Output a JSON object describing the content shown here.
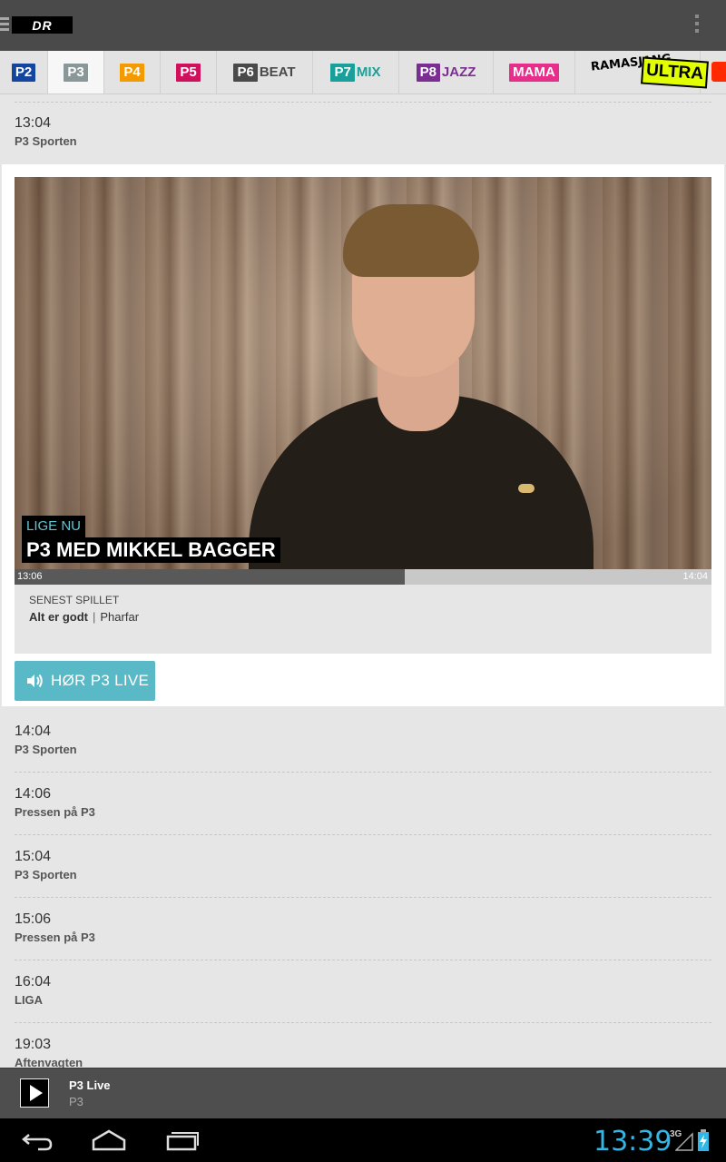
{
  "app": {
    "logo_text": "DR",
    "menu_icon": "hamburger-icon",
    "overflow_icon": "overflow-menu-icon"
  },
  "channels": [
    {
      "label": "P2",
      "color": "#1446a0",
      "suffix": ""
    },
    {
      "label": "P3",
      "color": "#8a9799",
      "suffix": "",
      "active": true
    },
    {
      "label": "P4",
      "color": "#f39a00",
      "suffix": ""
    },
    {
      "label": "P5",
      "color": "#d0105d",
      "suffix": ""
    },
    {
      "label": "P6",
      "color": "#4a4a4a",
      "suffix": "BEAT"
    },
    {
      "label": "P7",
      "color": "#1aa09a",
      "suffix": "MIX"
    },
    {
      "label": "P8",
      "color": "#7a2e92",
      "suffix": "JAZZ"
    },
    {
      "label": "MAMA",
      "color": "#e62e8a",
      "suffix": ""
    },
    {
      "label": "RAMASJANG",
      "color": "#e2ff00",
      "suffix": "ULTRA"
    }
  ],
  "schedule_before": [
    {
      "time": "13:04",
      "title": "P3 Sporten"
    }
  ],
  "now_playing": {
    "badge": "LIGE NU",
    "title": "P3 MED MIKKEL BAGGER",
    "start_time": "13:06",
    "end_time": "14:04",
    "progress": 0.56,
    "recent_label": "SENEST SPILLET",
    "recent_track": "Alt er godt",
    "recent_separator": "|",
    "recent_artist": "Pharfar",
    "listen_label": "HØR P3 LIVE",
    "listen_icon": "speaker-icon"
  },
  "schedule_after": [
    {
      "time": "14:04",
      "title": "P3 Sporten"
    },
    {
      "time": "14:06",
      "title": "Pressen på P3"
    },
    {
      "time": "15:04",
      "title": "P3 Sporten"
    },
    {
      "time": "15:06",
      "title": "Pressen på P3"
    },
    {
      "time": "16:04",
      "title": "LIGA"
    },
    {
      "time": "19:03",
      "title": "Aftenvagten"
    }
  ],
  "player": {
    "title": "P3 Live",
    "subtitle": "P3",
    "play_icon": "play-icon"
  },
  "system": {
    "clock": "13:39",
    "network": "3G",
    "nav_icons": [
      "back-icon",
      "home-icon",
      "recents-icon"
    ]
  },
  "colors": {
    "accent": "#5ab9c6",
    "clock": "#33b5e5"
  }
}
